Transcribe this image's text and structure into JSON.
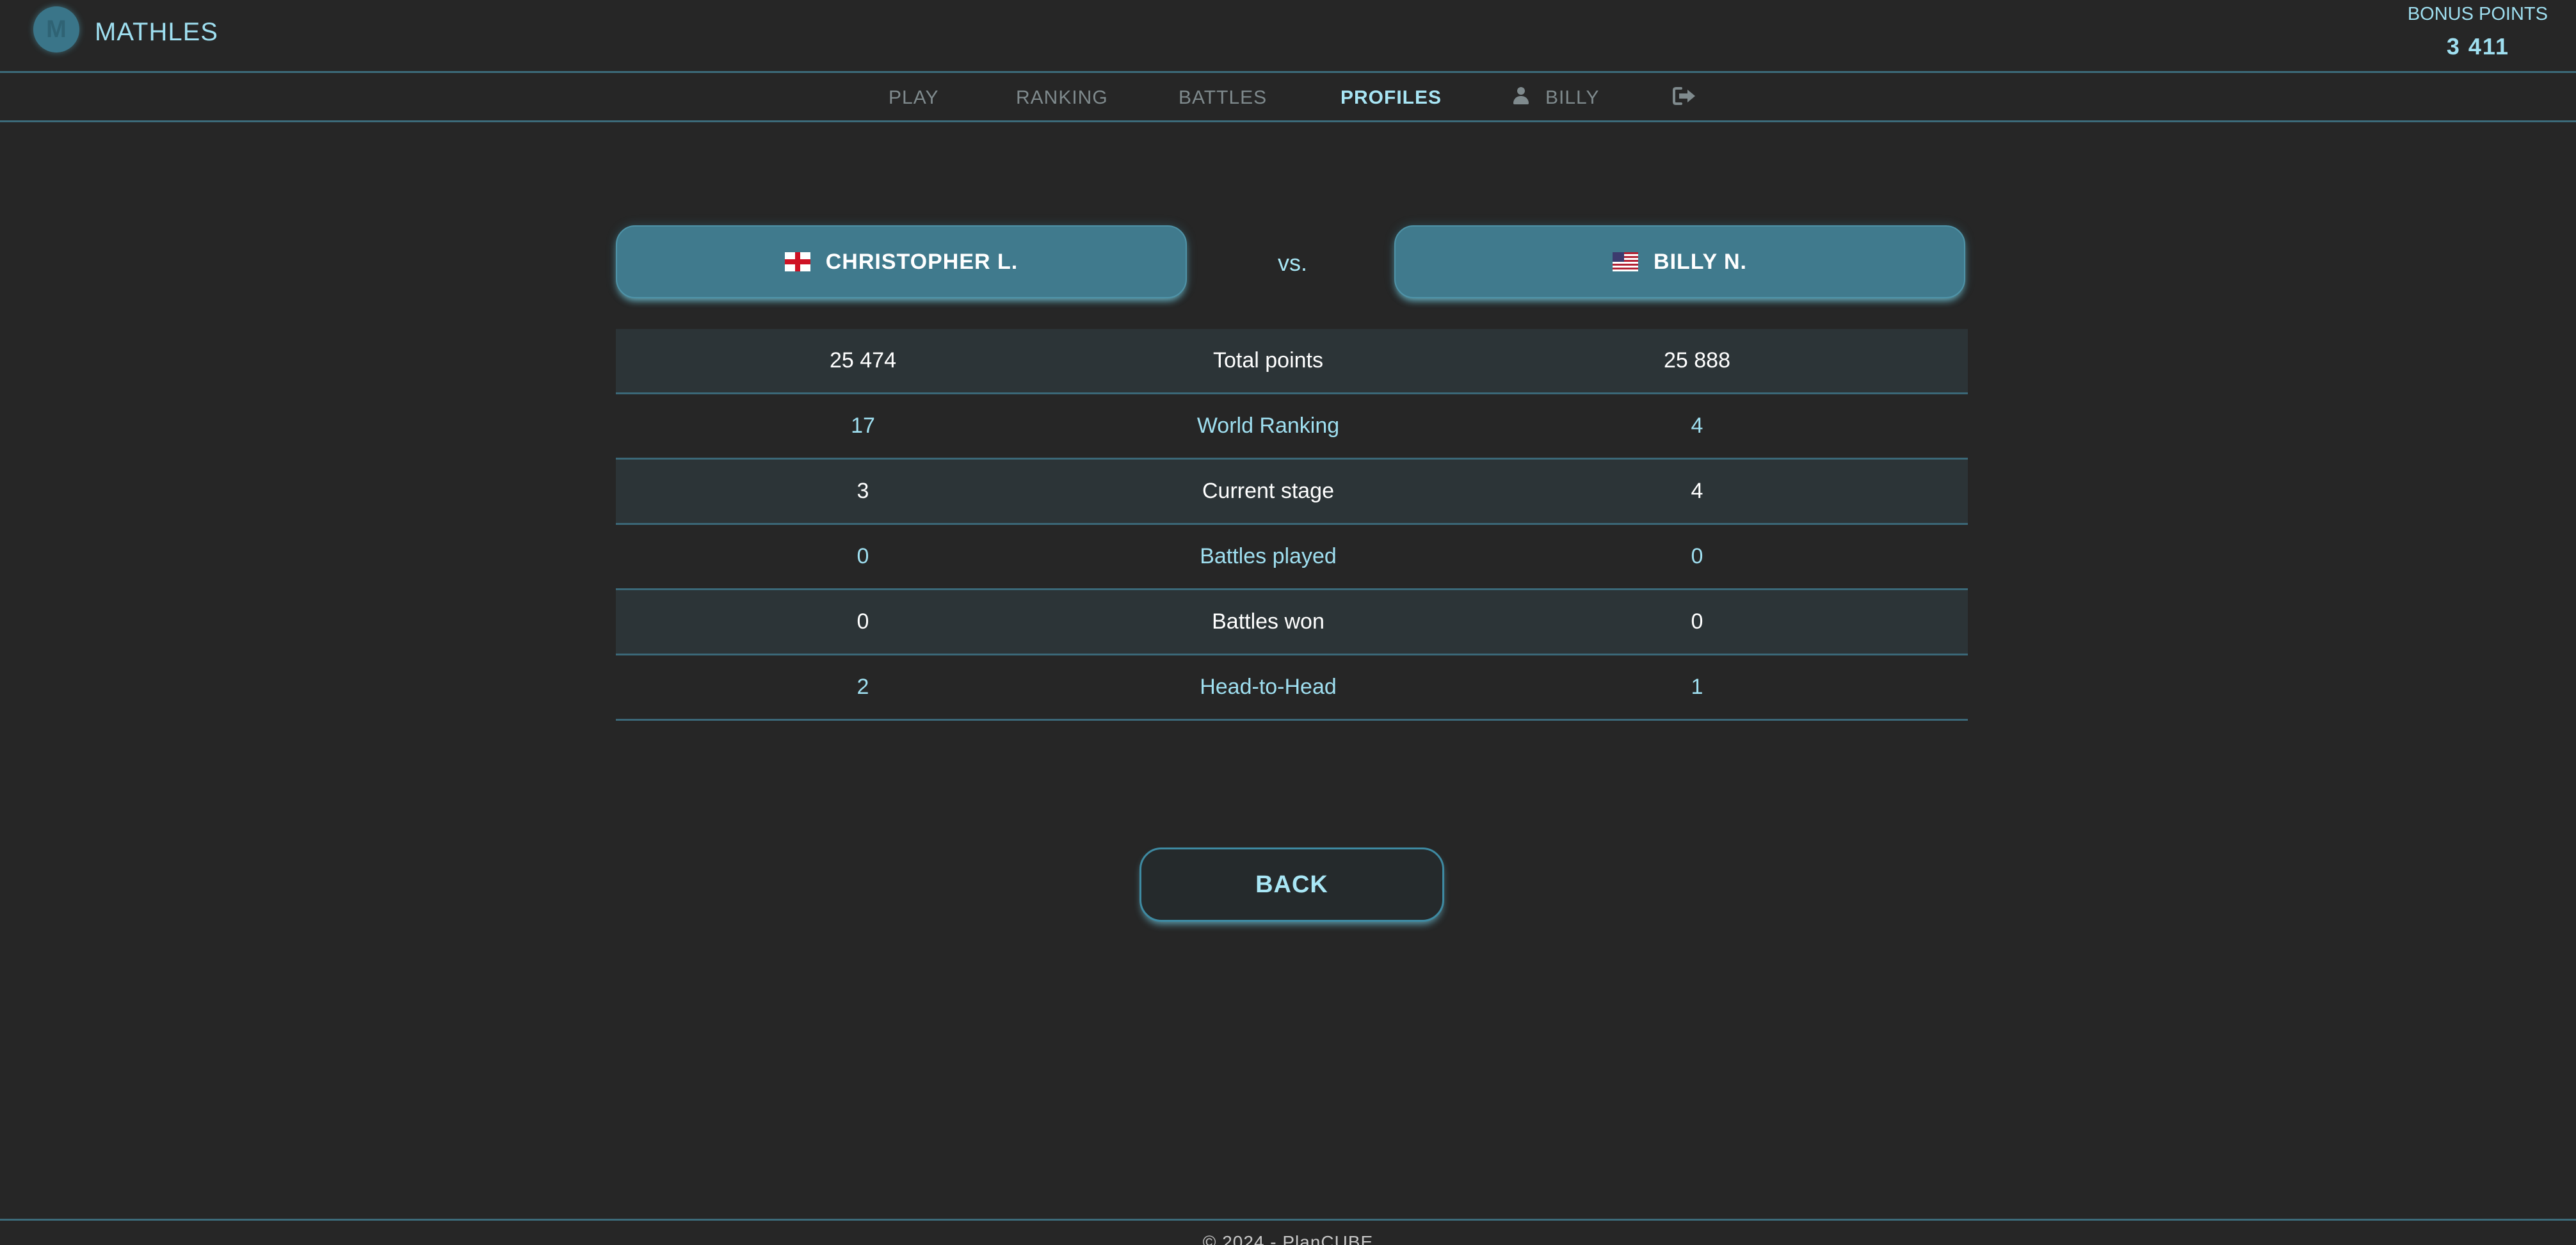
{
  "header": {
    "logo_letter": "M",
    "app_title": "MATHLES",
    "bonus_label": "BONUS POINTS",
    "bonus_value": "3 411"
  },
  "nav": {
    "items": [
      {
        "label": "PLAY",
        "active": false
      },
      {
        "label": "RANKING",
        "active": false
      },
      {
        "label": "BATTLES",
        "active": false
      },
      {
        "label": "PROFILES",
        "active": true
      }
    ],
    "user_label": "BILLY",
    "user_icon": "user-icon",
    "logout_icon": "logout-icon"
  },
  "comparison": {
    "player1": {
      "name": "CHRISTOPHER L.",
      "flag": "england-flag"
    },
    "vs_label": "vs.",
    "player2": {
      "name": "BILLY N.",
      "flag": "usa-flag"
    }
  },
  "stats": {
    "rows": [
      {
        "left": "25 474",
        "label": "Total points",
        "right": "25 888"
      },
      {
        "left": "17",
        "label": "World Ranking",
        "right": "4"
      },
      {
        "left": "3",
        "label": "Current stage",
        "right": "4"
      },
      {
        "left": "0",
        "label": "Battles played",
        "right": "0"
      },
      {
        "left": "0",
        "label": "Battles won",
        "right": "0"
      },
      {
        "left": "2",
        "label": "Head-to-Head",
        "right": "1"
      }
    ]
  },
  "back_label": "BACK",
  "footer": {
    "text": "© 2024 - PlanCUBE"
  },
  "colors": {
    "background": "#262626",
    "accent": "#9fdff0",
    "button_fill": "#407a8d",
    "divider": "#3c6b7a"
  }
}
